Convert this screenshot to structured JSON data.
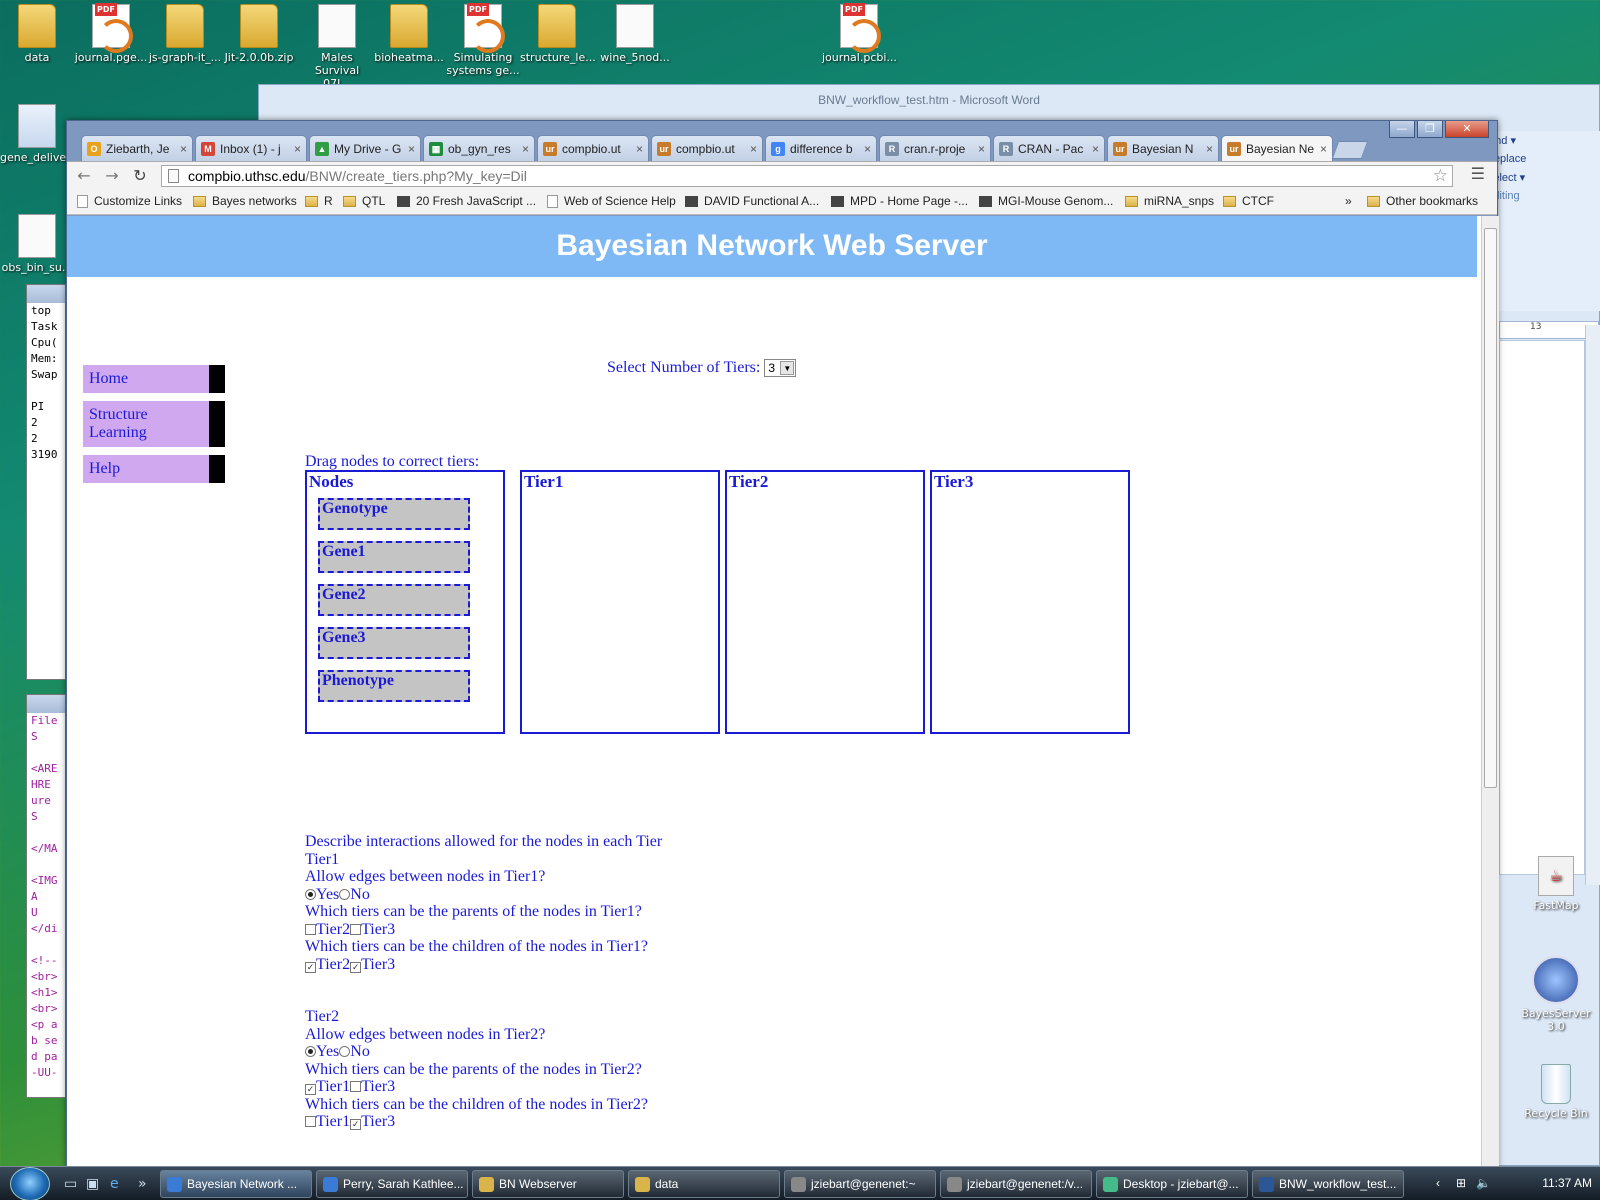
{
  "desktop": {
    "top_icons": [
      {
        "label": "data",
        "kind": "folder"
      },
      {
        "label": "journal.pge...",
        "kind": "pdf"
      },
      {
        "label": "js-graph-it_...",
        "kind": "folder"
      },
      {
        "label": "Jit-2.0.0b.zip",
        "kind": "folder"
      },
      {
        "label": "Males Survival 07J...",
        "kind": "file"
      },
      {
        "label": "bioheatma...",
        "kind": "folder"
      },
      {
        "label": "Simulating systems ge...",
        "kind": "pdf"
      },
      {
        "label": "structure_le...",
        "kind": "folder"
      },
      {
        "label": "wine_5nod...",
        "kind": "file"
      },
      {
        "label": "journal.pcbi...",
        "kind": "pdf"
      }
    ],
    "left_icons": [
      {
        "label": "gene_delive..."
      },
      {
        "label": "obs_bin_su..."
      }
    ],
    "right_icons": [
      {
        "label": "FastMap"
      },
      {
        "label": "BayesServer 3.0"
      },
      {
        "label": "Recycle Bin"
      }
    ],
    "pdf_tag": "PDF",
    "terminal1_lines": [
      "top",
      "Task",
      "Cpu(",
      "Mem:",
      "Swap",
      "",
      "PI",
      "2",
      "2",
      "3190"
    ],
    "terminal2_lines": [
      "File",
      "S",
      "",
      "<ARE",
      "HRE",
      "ure",
      "S",
      "",
      "</MA",
      "",
      "<IMG",
      "A",
      "U",
      "</di",
      "",
      "<!--",
      "<br>",
      "<h1>",
      "<br>",
      "<p a",
      "b se",
      "d pa",
      "-UU-"
    ]
  },
  "word": {
    "title": "BNW_workflow_test.htm - Microsoft Word",
    "ribbon": [
      "Find ▾",
      "Replace",
      "Select ▾",
      "Editing"
    ],
    "ruler": "13"
  },
  "browser": {
    "tabs": [
      {
        "label": "Ziebarth, Je",
        "fav_color": "#e8a21c",
        "fav_text": "O"
      },
      {
        "label": "Inbox (1) - j",
        "fav_color": "#d44638",
        "fav_text": "M"
      },
      {
        "label": "My Drive - G",
        "fav_color": "#2f9e44",
        "fav_text": "▲"
      },
      {
        "label": "ob_gyn_res",
        "fav_color": "#1e8e3e",
        "fav_text": "▦"
      },
      {
        "label": "compbio.ut",
        "fav_color": "#c77c2c",
        "fav_text": "ur"
      },
      {
        "label": "compbio.ut",
        "fav_color": "#c77c2c",
        "fav_text": "ur"
      },
      {
        "label": "difference b",
        "fav_color": "#4285f4",
        "fav_text": "g"
      },
      {
        "label": "cran.r-proje",
        "fav_color": "#7a8fa6",
        "fav_text": "R"
      },
      {
        "label": "CRAN - Pac",
        "fav_color": "#7a8fa6",
        "fav_text": "R"
      },
      {
        "label": "Bayesian N",
        "fav_color": "#c77c2c",
        "fav_text": "ur"
      },
      {
        "label": "Bayesian Ne",
        "fav_color": "#c77c2c",
        "fav_text": "ur",
        "active": true
      }
    ],
    "tab_close": "×",
    "url_host": "compbio.uthsc.edu",
    "url_path": "/BNW/create_tiers.php?My_key=Dil",
    "bookmarks": [
      {
        "label": "Customize Links",
        "icon": "p"
      },
      {
        "label": "Bayes networks",
        "icon": "f"
      },
      {
        "label": "R",
        "icon": "f"
      },
      {
        "label": "QTL",
        "icon": "f"
      },
      {
        "label": "20 Fresh JavaScript ...",
        "icon": "o"
      },
      {
        "label": "Web of Science Help",
        "icon": "p"
      },
      {
        "label": "DAVID Functional A...",
        "icon": "o"
      },
      {
        "label": "MPD - Home Page -...",
        "icon": "o"
      },
      {
        "label": "MGI-Mouse Genom...",
        "icon": "o"
      },
      {
        "label": "miRNA_snps",
        "icon": "f"
      },
      {
        "label": "CTCF",
        "icon": "f"
      }
    ],
    "bookmarks_more": "»",
    "other_bookmarks": "Other bookmarks"
  },
  "page": {
    "banner": "Bayesian Network Web Server",
    "nav": [
      "Home",
      "Structure Learning",
      "Help"
    ],
    "tier_select_label": "Select Number of Tiers:",
    "tier_select_value": "3",
    "drag_title": "Drag nodes to correct tiers:",
    "boxes": [
      "Nodes",
      "Tier1",
      "Tier2",
      "Tier3"
    ],
    "nodes": [
      "Genotype",
      "Gene1",
      "Gene2",
      "Gene3",
      "Phenotype"
    ],
    "describe_title": "Describe interactions allowed for the nodes in each Tier",
    "tier1": {
      "name": "Tier1",
      "edges_q": "Allow edges between nodes in Tier1?",
      "yes": "Yes",
      "no": "No",
      "parents_q": "Which tiers can be the parents of the nodes in Tier1?",
      "parents_opts": [
        "Tier2",
        "Tier3"
      ],
      "children_q": "Which tiers can be the children of the nodes in Tier1?",
      "children_opts": [
        "Tier2",
        "Tier3"
      ]
    },
    "tier2": {
      "name": "Tier2",
      "edges_q": "Allow edges between nodes in Tier2?",
      "yes": "Yes",
      "no": "No",
      "parents_q": "Which tiers can be the parents of the nodes in Tier2?",
      "parents_opts": [
        "Tier1",
        "Tier3"
      ],
      "children_q": "Which tiers can be the children of the nodes in Tier2?",
      "children_opts": [
        "Tier1",
        "Tier3"
      ]
    }
  },
  "taskbar": {
    "tasks": [
      {
        "label": "Bayesian Network ...",
        "color": "#3a7bd5",
        "active": true
      },
      {
        "label": "Perry, Sarah Kathlee...",
        "color": "#3a7bd5"
      },
      {
        "label": "BN Webserver",
        "color": "#d9b44a"
      },
      {
        "label": "data",
        "color": "#d9b44a"
      },
      {
        "label": "jziebart@genenet:~",
        "color": "#888"
      },
      {
        "label": "jziebart@genenet:/v...",
        "color": "#888"
      },
      {
        "label": "Desktop - jziebart@...",
        "color": "#4b8"
      },
      {
        "label": "BNW_workflow_test...",
        "color": "#2b5797"
      }
    ],
    "clock": "11:37 AM"
  }
}
